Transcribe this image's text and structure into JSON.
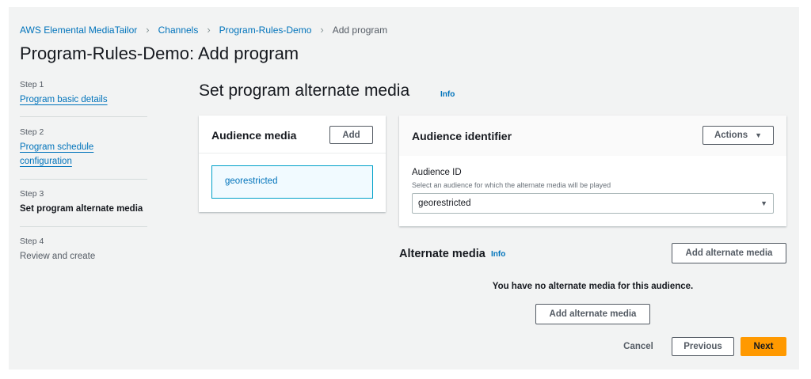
{
  "breadcrumb": [
    "AWS Elemental MediaTailor",
    "Channels",
    "Program-Rules-Demo",
    "Add program"
  ],
  "page_title": "Program-Rules-Demo: Add program",
  "steps": [
    {
      "number": "Step 1",
      "label": "Program basic details"
    },
    {
      "number": "Step 2",
      "label_line1": "Program schedule",
      "label_line2": "configuration"
    },
    {
      "number": "Step 3",
      "label": "Set program alternate media"
    },
    {
      "number": "Step 4",
      "label": "Review and create"
    }
  ],
  "section_title": "Set program alternate media",
  "info_label": "Info",
  "audience_media": {
    "title": "Audience media",
    "add_label": "Add",
    "items": [
      "georestricted"
    ]
  },
  "audience_identifier": {
    "title": "Audience identifier",
    "actions_label": "Actions",
    "field_label": "Audience ID",
    "field_description": "Select an audience for which the alternate media will be played",
    "selected_value": "georestricted"
  },
  "alternate_media": {
    "title": "Alternate media",
    "info_label": "Info",
    "add_label": "Add alternate media",
    "empty_text": "You have no alternate media for this audience.",
    "empty_add_label": "Add alternate media"
  },
  "footer": {
    "cancel": "Cancel",
    "previous": "Previous",
    "next": "Next"
  }
}
